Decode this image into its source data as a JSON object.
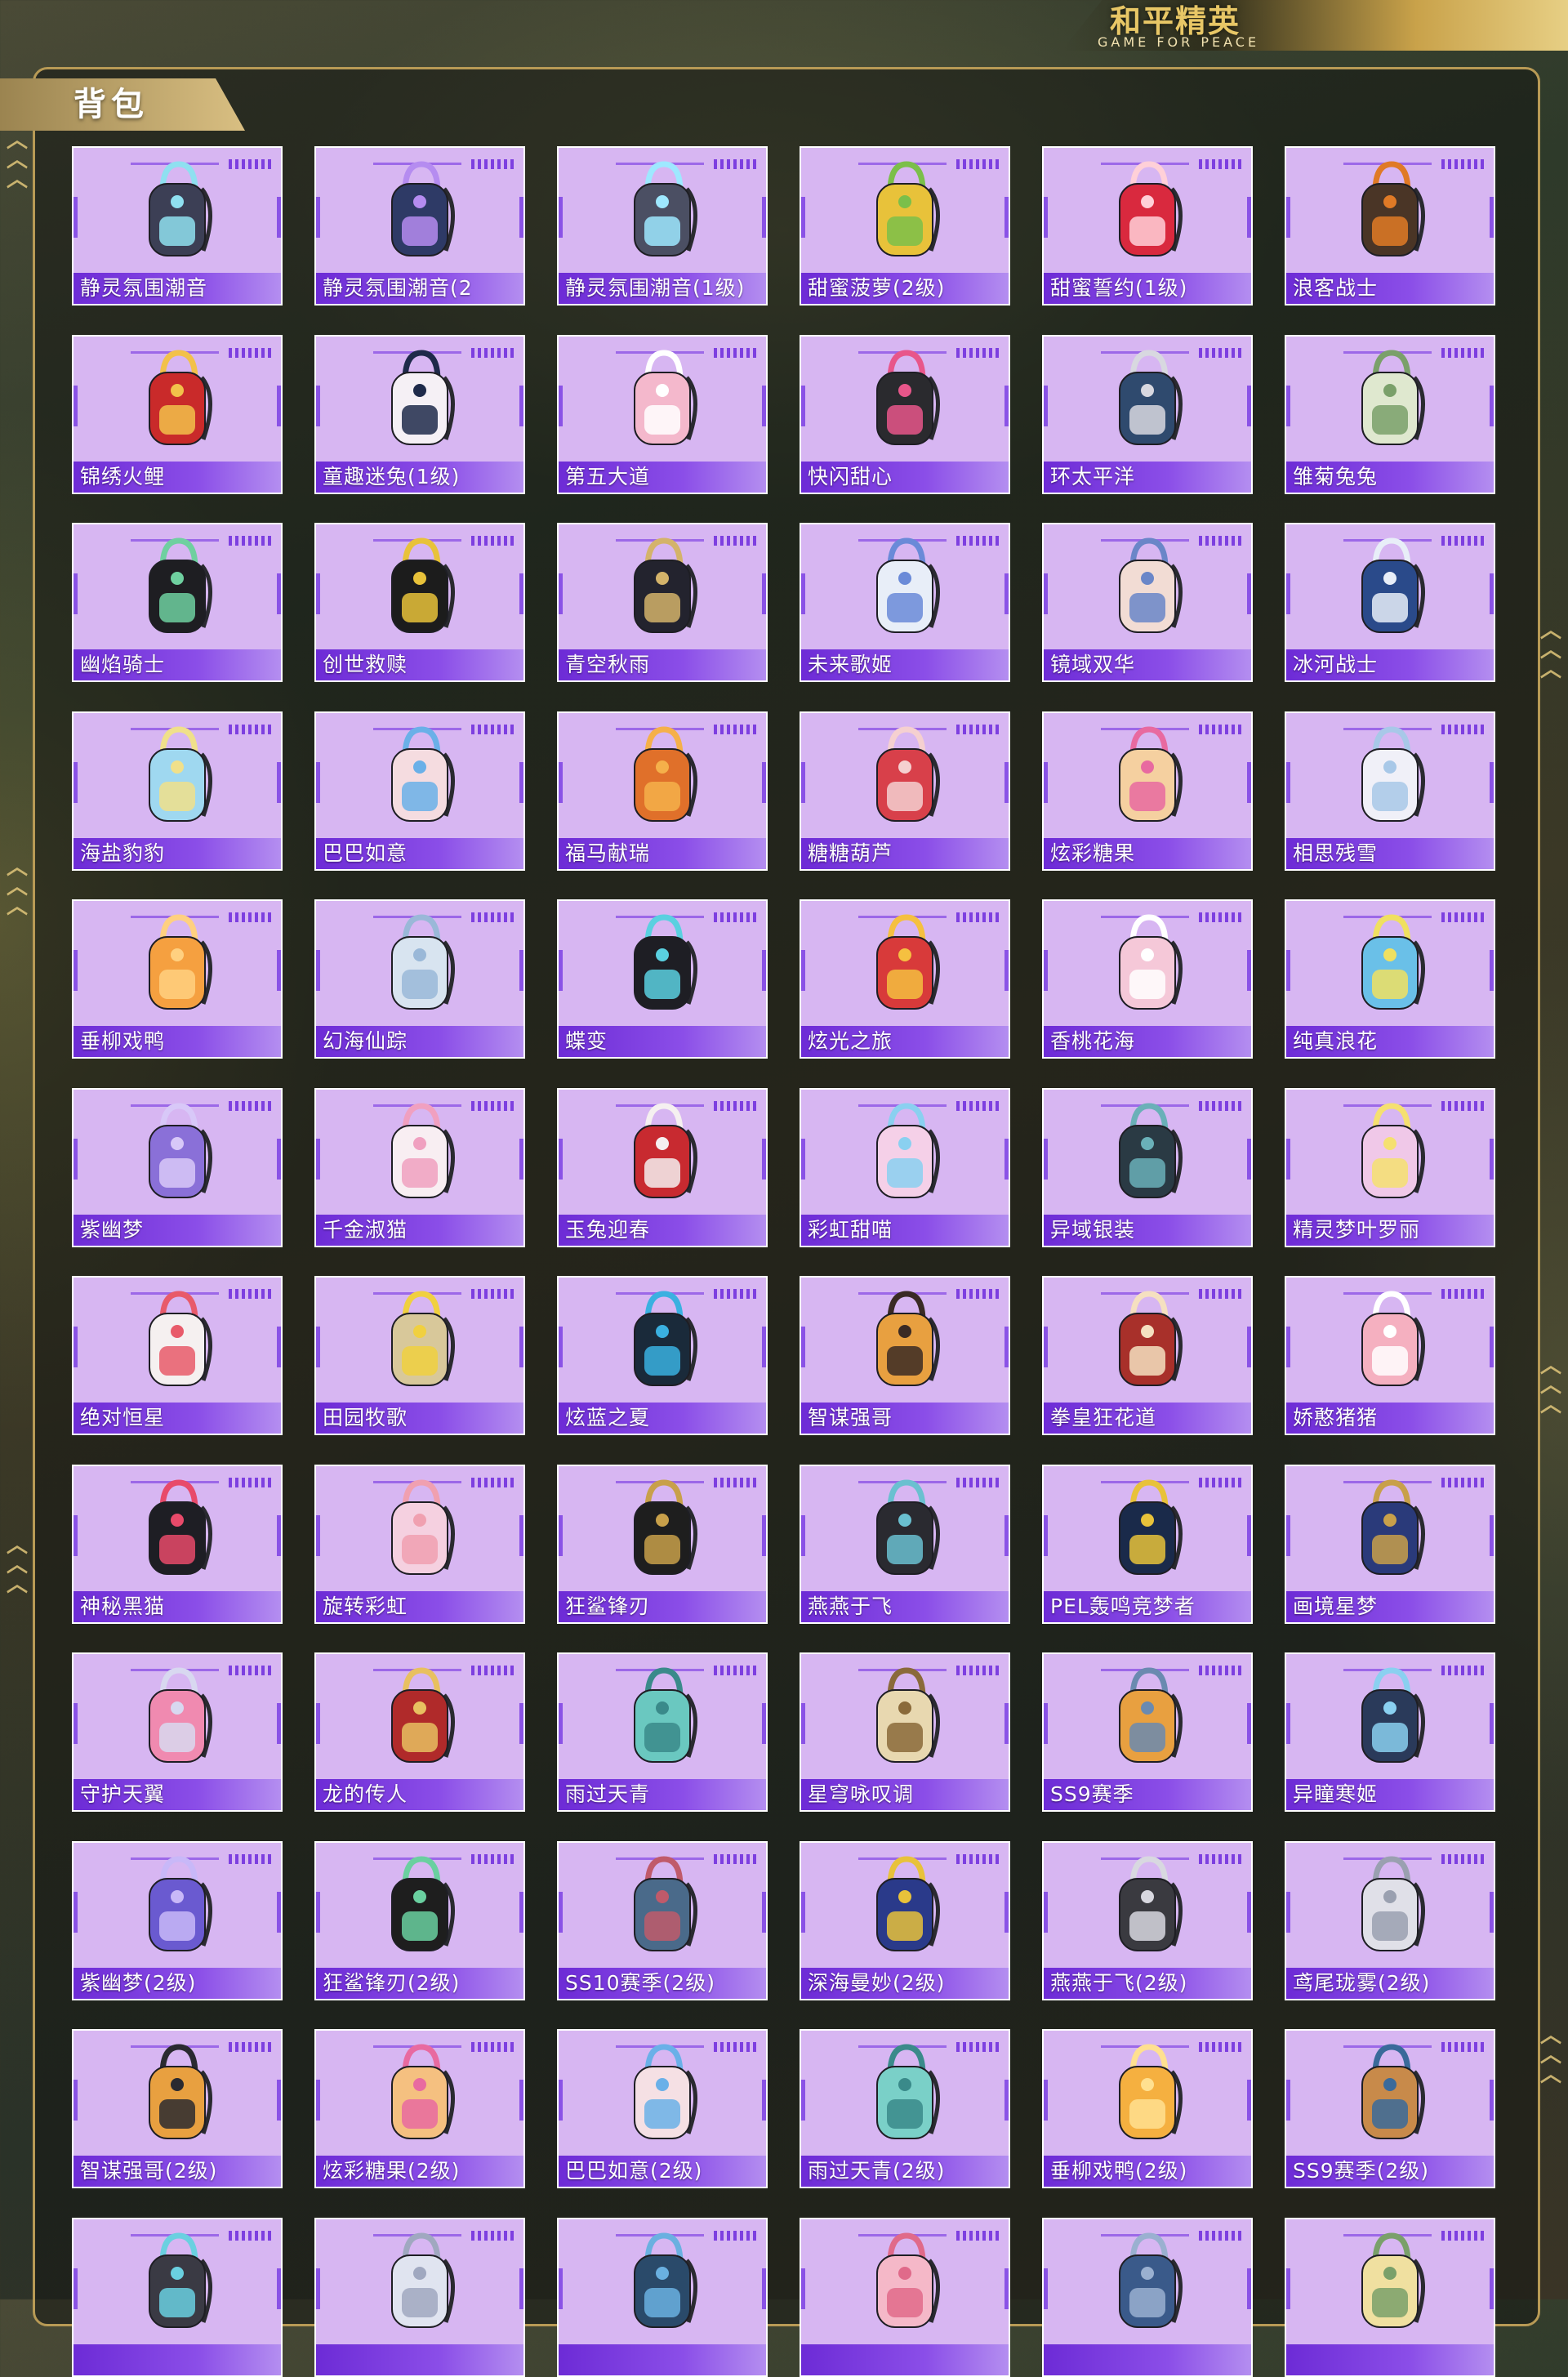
{
  "logo": {
    "title": "和平精英",
    "subtitle": "GAME FOR PEACE"
  },
  "section": {
    "title": "背包"
  },
  "colors": {
    "card_bg": "#d7b6f2",
    "label_bg": "#6d2bd6",
    "accent_gold": "#c9a24a"
  },
  "items": [
    {
      "label": "静灵氛围潮音",
      "icon": "tech-backpack-icon",
      "c1": "#3c3f55",
      "c2": "#8fe0f0"
    },
    {
      "label": "静灵氛围潮音(2",
      "icon": "tech-backpack-icon",
      "c1": "#2e3a66",
      "c2": "#b58cf0"
    },
    {
      "label": "静灵氛围潮音(1级)",
      "icon": "tech-backpack-icon",
      "c1": "#4b4f63",
      "c2": "#9ee8ff"
    },
    {
      "label": "甜蜜菠萝(2级)",
      "icon": "pineapple-backpack-icon",
      "c1": "#e8c23a",
      "c2": "#7bbf4a"
    },
    {
      "label": "甜蜜誓约(1级)",
      "icon": "heart-backpack-icon",
      "c1": "#d9293e",
      "c2": "#ffd0d8"
    },
    {
      "label": "浪客战士",
      "icon": "combat-backpack-icon",
      "c1": "#4a3526",
      "c2": "#e07a26"
    },
    {
      "label": "锦绣火鲤",
      "icon": "koi-backpack-icon",
      "c1": "#c92a2a",
      "c2": "#f2c14a"
    },
    {
      "label": "童趣迷兔(1级)",
      "icon": "bunny-backpack-icon",
      "c1": "#f5f0f5",
      "c2": "#1e2a4a"
    },
    {
      "label": "第五大道",
      "icon": "handbag-backpack-icon",
      "c1": "#f4b8cc",
      "c2": "#ffffff"
    },
    {
      "label": "快闪甜心",
      "icon": "sweet-backpack-icon",
      "c1": "#2a2a2e",
      "c2": "#e8568a"
    },
    {
      "label": "环太平洋",
      "icon": "mecha-backpack-icon",
      "c1": "#2f4a6e",
      "c2": "#d8d8e0"
    },
    {
      "label": "雏菊兔兔",
      "icon": "daisy-backpack-icon",
      "c1": "#dfe8cf",
      "c2": "#7aa06a"
    },
    {
      "label": "幽焰骑士",
      "icon": "knight-backpack-icon",
      "c1": "#1e1e22",
      "c2": "#6fd0a0"
    },
    {
      "label": "创世救赎",
      "icon": "helmet-backpack-icon",
      "c1": "#1c1c1c",
      "c2": "#e8c23a"
    },
    {
      "label": "青空秋雨",
      "icon": "ornate-backpack-icon",
      "c1": "#23232e",
      "c2": "#d4b36a"
    },
    {
      "label": "未来歌姬",
      "icon": "singer-backpack-icon",
      "c1": "#e8eef8",
      "c2": "#6a8ad8"
    },
    {
      "label": "镜域双华",
      "icon": "flower-backpack-icon",
      "c1": "#f2dcd4",
      "c2": "#6a86c8"
    },
    {
      "label": "冰河战士",
      "icon": "glacier-backpack-icon",
      "c1": "#2a4a8a",
      "c2": "#e8eef8"
    },
    {
      "label": "海盐豹豹",
      "icon": "leopard-backpack-icon",
      "c1": "#9fd8f0",
      "c2": "#f0e08a"
    },
    {
      "label": "巴巴如意",
      "icon": "lucky-backpack-icon",
      "c1": "#f5dce0",
      "c2": "#6ab0e8"
    },
    {
      "label": "福马献瑞",
      "icon": "horse-backpack-icon",
      "c1": "#e0702a",
      "c2": "#f5b04a"
    },
    {
      "label": "糖糖葫芦",
      "icon": "candy-backpack-icon",
      "c1": "#d8404a",
      "c2": "#f5d0d0"
    },
    {
      "label": "炫彩糖果",
      "icon": "donut-backpack-icon",
      "c1": "#f5d0a0",
      "c2": "#e86aa0"
    },
    {
      "label": "相思残雪",
      "icon": "snow-backpack-icon",
      "c1": "#f0f0f8",
      "c2": "#a8c8e8"
    },
    {
      "label": "垂柳戏鸭",
      "icon": "duck-backpack-icon",
      "c1": "#f5a040",
      "c2": "#ffd080"
    },
    {
      "label": "幻海仙踪",
      "icon": "crystal-backpack-icon",
      "c1": "#d8e4f0",
      "c2": "#9ab8d8"
    },
    {
      "label": "蝶变",
      "icon": "butterfly-backpack-icon",
      "c1": "#1e1e24",
      "c2": "#5ad0e0"
    },
    {
      "label": "炫光之旅",
      "icon": "monster-backpack-icon",
      "c1": "#d83a3a",
      "c2": "#f5c040"
    },
    {
      "label": "香桃花海",
      "icon": "peach-backpack-icon",
      "c1": "#f5c8d8",
      "c2": "#ffffff"
    },
    {
      "label": "纯真浪花",
      "icon": "drink-backpack-icon",
      "c1": "#6ac0e8",
      "c2": "#f0e060"
    },
    {
      "label": "紫幽梦",
      "icon": "purple-backpack-icon",
      "c1": "#8a70d8",
      "c2": "#d8c8f8"
    },
    {
      "label": "千金淑猫",
      "icon": "cat-backpack-icon",
      "c1": "#f8eef2",
      "c2": "#f0a0c0"
    },
    {
      "label": "玉兔迎春",
      "icon": "rabbit-backpack-icon",
      "c1": "#c82a30",
      "c2": "#f5f0f0"
    },
    {
      "label": "彩虹甜喵",
      "icon": "rainbow-cat-backpack-icon",
      "c1": "#f5d0e8",
      "c2": "#8ad0f0"
    },
    {
      "label": "异域银装",
      "icon": "armor-backpack-icon",
      "c1": "#2a3a44",
      "c2": "#6ab0b8"
    },
    {
      "label": "精灵梦叶罗丽",
      "icon": "fairy-backpack-icon",
      "c1": "#f0c8e8",
      "c2": "#f5e070"
    },
    {
      "label": "绝对恒星",
      "icon": "popcorn-backpack-icon",
      "c1": "#f5f0f0",
      "c2": "#e85a6a"
    },
    {
      "label": "田园牧歌",
      "icon": "basket-backpack-icon",
      "c1": "#d8c89a",
      "c2": "#f0d040"
    },
    {
      "label": "炫蓝之夏",
      "icon": "blue-skull-backpack-icon",
      "c1": "#1a2a3a",
      "c2": "#3ab0e0"
    },
    {
      "label": "智谋强哥",
      "icon": "pig-backpack-icon",
      "c1": "#e8a040",
      "c2": "#3a2a24"
    },
    {
      "label": "拳皇狂花道",
      "icon": "fighter-backpack-icon",
      "c1": "#a8302a",
      "c2": "#f5e0c0"
    },
    {
      "label": "娇憨猪猪",
      "icon": "piggy-backpack-icon",
      "c1": "#f5b0c0",
      "c2": "#ffffff"
    },
    {
      "label": "神秘黑猫",
      "icon": "black-cat-backpack-icon",
      "c1": "#1e1e24",
      "c2": "#e84a6a"
    },
    {
      "label": "旋转彩虹",
      "icon": "cake-backpack-icon",
      "c1": "#f5d0e0",
      "c2": "#f0a0b0"
    },
    {
      "label": "狂鲨锋刃",
      "icon": "shark-backpack-icon",
      "c1": "#1e1e1e",
      "c2": "#c8a04a"
    },
    {
      "label": "燕燕于飞",
      "icon": "swallow-backpack-icon",
      "c1": "#2a2a30",
      "c2": "#6ac0d0"
    },
    {
      "label": "PEL轰鸣竞梦者",
      "icon": "pel-backpack-icon",
      "c1": "#1a2a4a",
      "c2": "#e8c23a"
    },
    {
      "label": "画境星梦",
      "icon": "starry-backpack-icon",
      "c1": "#2a3a7a",
      "c2": "#c8a04a"
    },
    {
      "label": "守护天翼",
      "icon": "wing-backpack-icon",
      "c1": "#f08ab0",
      "c2": "#d8d8f0"
    },
    {
      "label": "龙的传人",
      "icon": "dragon-backpack-icon",
      "c1": "#b02a2a",
      "c2": "#e8c060"
    },
    {
      "label": "雨过天青",
      "icon": "celadon-backpack-icon",
      "c1": "#6ac8c0",
      "c2": "#3a8a8a"
    },
    {
      "label": "星穹咏叹调",
      "icon": "cathedral-backpack-icon",
      "c1": "#e8d8b0",
      "c2": "#8a6a3a"
    },
    {
      "label": "SS9赛季",
      "icon": "season-backpack-icon",
      "c1": "#e8a040",
      "c2": "#6a8ab0"
    },
    {
      "label": "异瞳寒姬",
      "icon": "ice-cat-backpack-icon",
      "c1": "#2a3a5a",
      "c2": "#8ad0f0"
    },
    {
      "label": "紫幽梦(2级)",
      "icon": "purple-backpack-icon",
      "c1": "#6a5ad0",
      "c2": "#c8b8f8"
    },
    {
      "label": "狂鲨锋刃(2级)",
      "icon": "shark-backpack-icon",
      "c1": "#1e1e1e",
      "c2": "#6ad0a0"
    },
    {
      "label": "SS10赛季(2级)",
      "icon": "season-backpack-icon",
      "c1": "#4a6a8a",
      "c2": "#c05a6a"
    },
    {
      "label": "深海曼妙(2级)",
      "icon": "deep-sea-backpack-icon",
      "c1": "#2a3a8a",
      "c2": "#e8c23a"
    },
    {
      "label": "燕燕于飞(2级)",
      "icon": "swallow-backpack-icon",
      "c1": "#3a3a40",
      "c2": "#d8d8e0"
    },
    {
      "label": "鸢尾珑雾(2级)",
      "icon": "iris-backpack-icon",
      "c1": "#e0e0e8",
      "c2": "#9aa0b0"
    },
    {
      "label": "智谋强哥(2级)",
      "icon": "pig-backpack-icon",
      "c1": "#e8a040",
      "c2": "#2a2a30"
    },
    {
      "label": "炫彩糖果(2级)",
      "icon": "donut-backpack-icon",
      "c1": "#f5c080",
      "c2": "#e86aa0"
    },
    {
      "label": "巴巴如意(2级)",
      "icon": "lucky-backpack-icon",
      "c1": "#f5e0e4",
      "c2": "#6ab0e8"
    },
    {
      "label": "雨过天青(2级)",
      "icon": "celadon-backpack-icon",
      "c1": "#7ad0c8",
      "c2": "#3a8a8a"
    },
    {
      "label": "垂柳戏鸭(2级)",
      "icon": "duck-backpack-icon",
      "c1": "#f5b040",
      "c2": "#ffe090"
    },
    {
      "label": "SS9赛季(2级)",
      "icon": "season-backpack-icon",
      "c1": "#c88a4a",
      "c2": "#3a6a9a"
    },
    {
      "label": "",
      "icon": "tech-backpack-icon",
      "c1": "#3a3a44",
      "c2": "#6ad0e0"
    },
    {
      "label": "",
      "icon": "crystal-backpack-icon",
      "c1": "#e0e4f0",
      "c2": "#a0a8c0"
    },
    {
      "label": "",
      "icon": "mecha-backpack-icon",
      "c1": "#2a4a6a",
      "c2": "#6ab0e0"
    },
    {
      "label": "",
      "icon": "piggy-backpack-icon",
      "c1": "#f5b8c8",
      "c2": "#e06a8a"
    },
    {
      "label": "",
      "icon": "armor-backpack-icon",
      "c1": "#3a5a8a",
      "c2": "#9ab0d0"
    },
    {
      "label": "",
      "icon": "daisy-backpack-icon",
      "c1": "#f0e0a0",
      "c2": "#7aa06a"
    }
  ]
}
